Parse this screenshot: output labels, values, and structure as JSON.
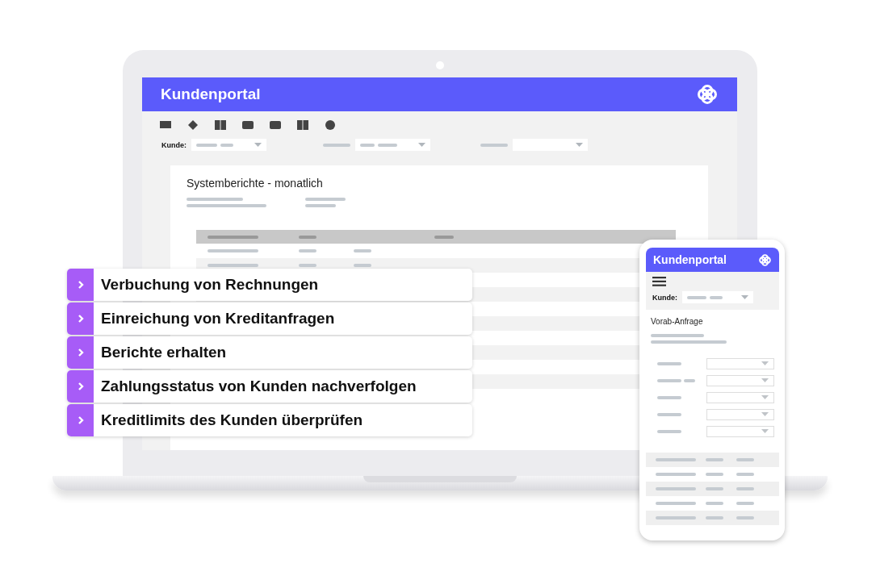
{
  "laptop": {
    "header": {
      "title": "Kundenportal"
    },
    "filter_label": "Kunde:",
    "report": {
      "title": "Systemberichte - monatlich"
    }
  },
  "features": [
    {
      "label": "Verbuchung von Rechnungen"
    },
    {
      "label": "Einreichung von Kreditanfragen"
    },
    {
      "label": "Berichte erhalten"
    },
    {
      "label": "Zahlungsstatus von Kunden nachverfolgen"
    },
    {
      "label": "Kreditlimits des Kunden überprüfen"
    }
  ],
  "phone": {
    "header": {
      "title": "Kundenportal"
    },
    "filter_label": "Kunde:",
    "form_title": "Vorab-Anfrage"
  }
}
